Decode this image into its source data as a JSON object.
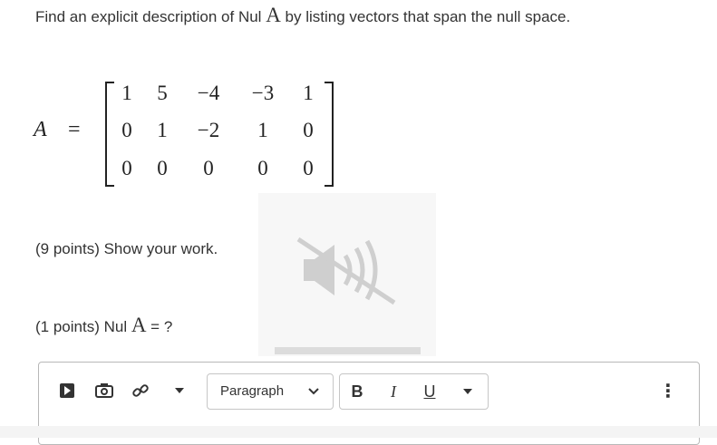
{
  "question": {
    "prefix": "Find an explicit description of Nul ",
    "matrix_symbol": "A",
    "suffix": " by listing vectors that span the null space."
  },
  "matrix": {
    "label": "A",
    "equals": "=",
    "rows": [
      [
        "1",
        "5",
        "−4",
        "−3",
        "1"
      ],
      [
        "0",
        "1",
        "−2",
        "1",
        "0"
      ],
      [
        "0",
        "0",
        "0",
        "0",
        "0"
      ]
    ]
  },
  "work_prompt": "(9 points) Show your work.",
  "answer_prompt": {
    "prefix": "(1 points) Nul ",
    "matrix_symbol": "A",
    "suffix": " = ?"
  },
  "overlay": {
    "icon": "speaker-muted-icon"
  },
  "toolbar": {
    "format_label": "Paragraph",
    "bold_label": "B",
    "italic_label": "I",
    "underline_label": "U",
    "more_label": "⋮",
    "icons": [
      "insert-stuff-icon",
      "insert-image-icon",
      "insert-link-icon",
      "dropdown-icon",
      "chevron-down-icon",
      "dropdown-icon",
      "more-icon"
    ]
  }
}
